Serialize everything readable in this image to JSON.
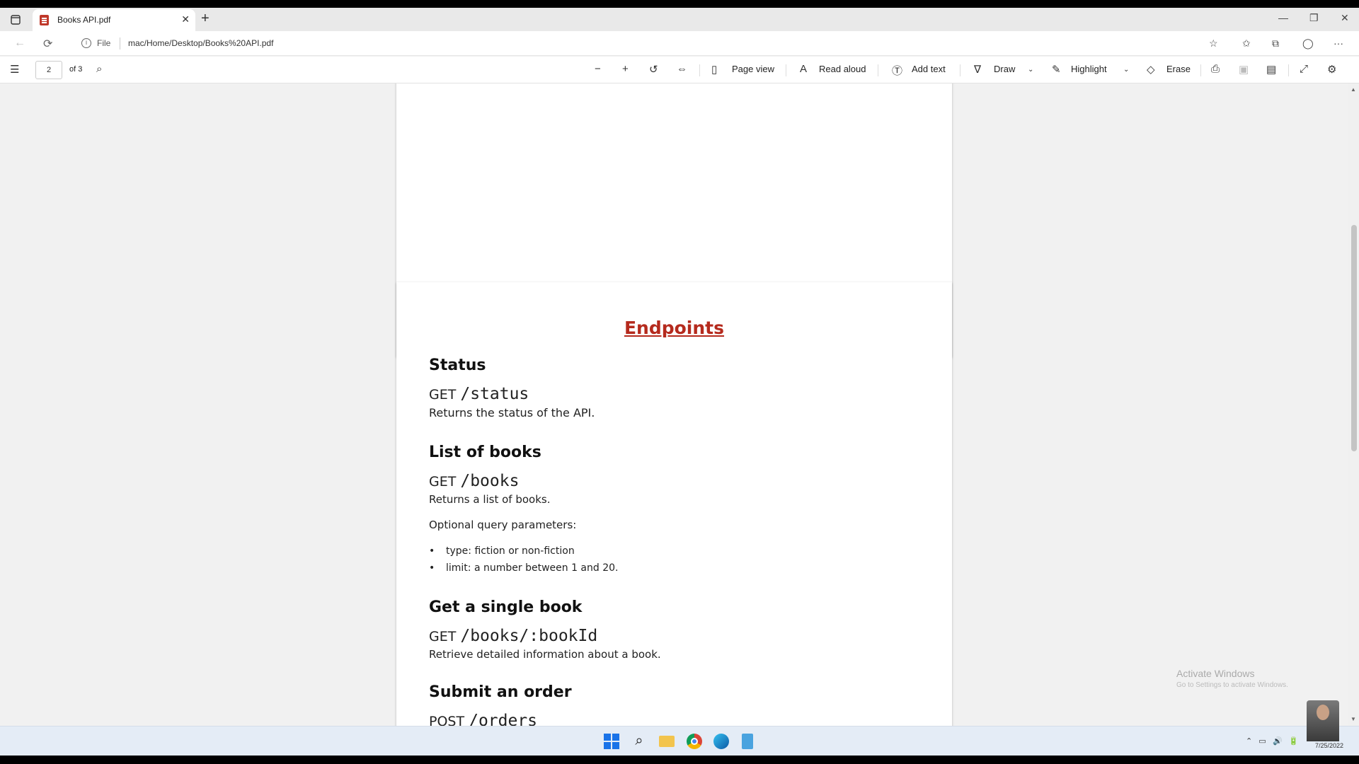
{
  "browser": {
    "tab_title": "Books API.pdf",
    "tab_close": "✕",
    "new_tab": "+",
    "file_label": "File",
    "url": "mac/Home/Desktop/Books%20API.pdf"
  },
  "pdf_toolbar": {
    "page_number": "2",
    "page_total": "of 3",
    "page_view": "Page view",
    "read_aloud": "Read aloud",
    "add_text": "Add text",
    "draw": "Draw",
    "highlight": "Highlight",
    "erase": "Erase"
  },
  "document": {
    "title": "Endpoints",
    "sections": [
      {
        "heading": "Status",
        "method": "GET",
        "path": "/status",
        "description": "Returns the status of the API."
      },
      {
        "heading": "List of books",
        "method": "GET",
        "path": "/books",
        "description": "Returns a list of books.",
        "params_intro": "Optional query parameters:",
        "params": [
          "type: fiction or non-fiction",
          "limit: a number between 1 and 20."
        ]
      },
      {
        "heading": "Get a single book",
        "method": "GET",
        "path": "/books/:bookId",
        "description": "Retrieve detailed information about a book."
      },
      {
        "heading": "Submit an order",
        "method": "POST",
        "path": "/orders"
      }
    ]
  },
  "watermark": {
    "title": "Activate Windows",
    "subtitle": "Go to Settings to activate Windows."
  },
  "taskbar": {
    "date": "7/25/2022"
  },
  "colors": {
    "title_red": "#b52a1d",
    "windows_blue": "#1a73e8"
  }
}
